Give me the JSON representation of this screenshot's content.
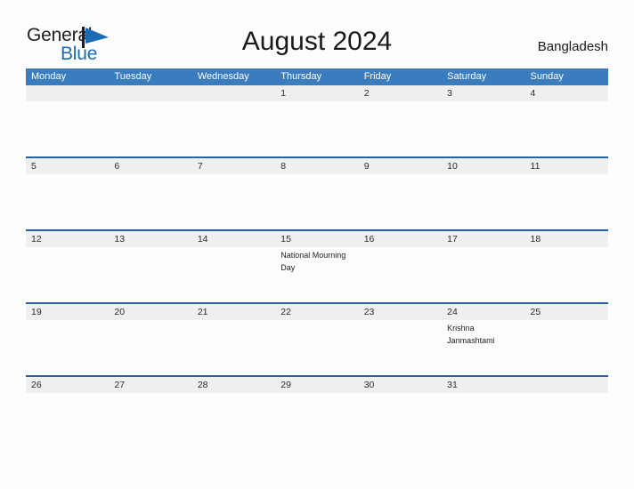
{
  "brand": {
    "word_one": "General",
    "word_two": "Blue",
    "flag_icon": "blue-triangle-flag-icon",
    "color_dark": "#231f20",
    "color_blue": "#1b6cb3"
  },
  "header": {
    "title": "August 2024",
    "country": "Bangladesh"
  },
  "colors": {
    "header_bar": "#3a7cbe",
    "row_separator": "#2a6099",
    "date_strip": "#efefef",
    "page_background": "#fdfdfd"
  },
  "calendar": {
    "weekdays": [
      {
        "label": "Monday"
      },
      {
        "label": "Tuesday"
      },
      {
        "label": "Wednesday"
      },
      {
        "label": "Thursday"
      },
      {
        "label": "Friday"
      },
      {
        "label": "Saturday"
      },
      {
        "label": "Sunday"
      }
    ],
    "weeks": [
      {
        "days": [
          {
            "date": "",
            "event": ""
          },
          {
            "date": "",
            "event": ""
          },
          {
            "date": "",
            "event": ""
          },
          {
            "date": "1",
            "event": ""
          },
          {
            "date": "2",
            "event": ""
          },
          {
            "date": "3",
            "event": ""
          },
          {
            "date": "4",
            "event": ""
          }
        ]
      },
      {
        "days": [
          {
            "date": "5",
            "event": ""
          },
          {
            "date": "6",
            "event": ""
          },
          {
            "date": "7",
            "event": ""
          },
          {
            "date": "8",
            "event": ""
          },
          {
            "date": "9",
            "event": ""
          },
          {
            "date": "10",
            "event": ""
          },
          {
            "date": "11",
            "event": ""
          }
        ]
      },
      {
        "days": [
          {
            "date": "12",
            "event": ""
          },
          {
            "date": "13",
            "event": ""
          },
          {
            "date": "14",
            "event": ""
          },
          {
            "date": "15",
            "event": "National Mourning Day"
          },
          {
            "date": "16",
            "event": ""
          },
          {
            "date": "17",
            "event": ""
          },
          {
            "date": "18",
            "event": ""
          }
        ]
      },
      {
        "days": [
          {
            "date": "19",
            "event": ""
          },
          {
            "date": "20",
            "event": ""
          },
          {
            "date": "21",
            "event": ""
          },
          {
            "date": "22",
            "event": ""
          },
          {
            "date": "23",
            "event": ""
          },
          {
            "date": "24",
            "event": "Krishna Janmashtami"
          },
          {
            "date": "25",
            "event": ""
          }
        ]
      },
      {
        "days": [
          {
            "date": "26",
            "event": ""
          },
          {
            "date": "27",
            "event": ""
          },
          {
            "date": "28",
            "event": ""
          },
          {
            "date": "29",
            "event": ""
          },
          {
            "date": "30",
            "event": ""
          },
          {
            "date": "31",
            "event": ""
          },
          {
            "date": "",
            "event": ""
          }
        ]
      }
    ]
  }
}
